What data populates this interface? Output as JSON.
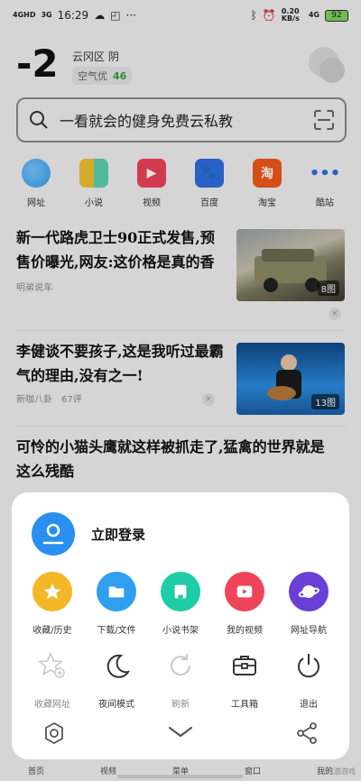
{
  "status": {
    "left_text": "16:29",
    "net_left_1": "4GHD",
    "net_left_2": "3G",
    "speed": "0.20 KB/s",
    "net_right": "4G",
    "battery": "92"
  },
  "weather": {
    "temp": "-2",
    "location": "云冈区  阴",
    "aqi_label": "空气优",
    "aqi_value": "46"
  },
  "search": {
    "placeholder": "一看就会的健身免费云私教"
  },
  "shortcuts": [
    {
      "label": "网址",
      "color": "#2f9ff0"
    },
    {
      "label": "小说",
      "color": "#f2c230"
    },
    {
      "label": "视频",
      "color": "#f0445a"
    },
    {
      "label": "百度",
      "color": "#2f6fe0"
    },
    {
      "label": "淘宝",
      "color": "#f25a1b"
    },
    {
      "label": "酷站",
      "color": "#2f6fe0"
    }
  ],
  "news": [
    {
      "title": "新一代路虎卫士90正式发售,预售价曝光,网友:这价格是真的香",
      "source": "明弟说车",
      "comments": "",
      "image_count": "8图"
    },
    {
      "title": "李健谈不要孩子,这是我听过最霸气的理由,没有之一!",
      "source": "新咖八卦",
      "comments": "67评",
      "image_count": "13图"
    },
    {
      "title": "可怜的小猫头鹰就这样被抓走了,猛禽的世界就是这么残酷",
      "source": "",
      "comments": "",
      "image_count": ""
    }
  ],
  "sheet": {
    "login_label": "立即登录",
    "row1": [
      {
        "label": "收藏/历史",
        "color": "#f4b728",
        "icon": "star-icon"
      },
      {
        "label": "下载/文件",
        "color": "#2f9ff0",
        "icon": "folder-icon"
      },
      {
        "label": "小说书架",
        "color": "#1ecda7",
        "icon": "book-icon"
      },
      {
        "label": "我的视频",
        "color": "#f0445a",
        "icon": "play-icon"
      },
      {
        "label": "网址导航",
        "color": "#6a3fd6",
        "icon": "planet-icon"
      }
    ],
    "row2": [
      {
        "label": "收藏网址",
        "icon": "star-add-icon",
        "dim": true
      },
      {
        "label": "夜间模式",
        "icon": "moon-icon",
        "dim": false
      },
      {
        "label": "刷新",
        "icon": "refresh-icon",
        "dim": true
      },
      {
        "label": "工具箱",
        "icon": "toolbox-icon",
        "dim": false
      },
      {
        "label": "退出",
        "icon": "power-icon",
        "dim": false
      }
    ]
  },
  "navbar": [
    "首页",
    "视频",
    "菜单",
    "窗口",
    "我的"
  ],
  "watermark": "九游游戏"
}
